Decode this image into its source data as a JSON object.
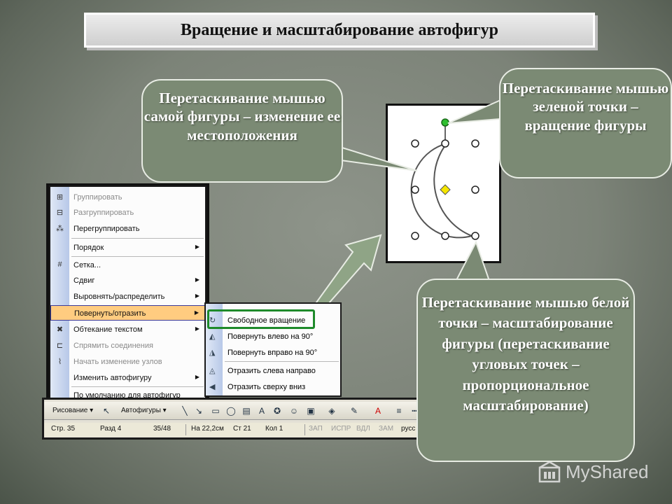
{
  "title": "Вращение и масштабирование автофигур",
  "callouts": {
    "move": "Перетаскивание мышью самой фигуры – изменение ее местоположения",
    "rotate": "Перетаскивание мышью зеленой точки – вращение фигуры",
    "scale": "Перетаскивание мышью белой точки – масштабирование фигуры (перетаскивание угловых точек – пропорциональное масштабирование)"
  },
  "menu": {
    "items": [
      {
        "label": "Группировать",
        "icon": "group-icon",
        "disabled": true,
        "submenu": false
      },
      {
        "label": "Разгруппировать",
        "icon": "ungroup-icon",
        "disabled": true,
        "submenu": false
      },
      {
        "label": "Перегруппировать",
        "icon": "regroup-icon",
        "disabled": false,
        "submenu": false
      },
      {
        "label": "Порядок",
        "icon": "",
        "disabled": false,
        "submenu": true
      },
      {
        "label": "Сетка...",
        "icon": "grid-icon",
        "disabled": false,
        "submenu": false
      },
      {
        "label": "Сдвиг",
        "icon": "",
        "disabled": false,
        "submenu": true
      },
      {
        "label": "Выровнять/распределить",
        "icon": "",
        "disabled": false,
        "submenu": true
      },
      {
        "label": "Повернуть/отразить",
        "icon": "",
        "disabled": false,
        "submenu": true,
        "selected": true
      },
      {
        "label": "Обтекание текстом",
        "icon": "text-wrap-icon",
        "disabled": false,
        "submenu": true
      },
      {
        "label": "Спрямить соединения",
        "icon": "straighten-icon",
        "disabled": true,
        "submenu": false
      },
      {
        "label": "Начать изменение узлов",
        "icon": "edit-points-icon",
        "disabled": true,
        "submenu": false
      },
      {
        "label": "Изменить автофигуру",
        "icon": "",
        "disabled": false,
        "submenu": true
      },
      {
        "label": "По умолчанию для автофигур",
        "icon": "",
        "disabled": false,
        "submenu": false
      }
    ]
  },
  "submenu": {
    "items": [
      {
        "label": "Свободное вращение",
        "icon": "free-rotate-icon"
      },
      {
        "label": "Повернуть влево на 90°",
        "icon": "rotate-left-icon"
      },
      {
        "label": "Повернуть вправо на 90°",
        "icon": "rotate-right-icon"
      },
      {
        "label": "Отразить слева направо",
        "icon": "flip-horizontal-icon"
      },
      {
        "label": "Отразить сверху вниз",
        "icon": "flip-vertical-icon"
      }
    ]
  },
  "toolbar": {
    "draw_label": "Рисование ▾",
    "autoshapes_label": "Автофигуры ▾"
  },
  "statusbar": {
    "page": "Стр.  35",
    "section": "Разд  4",
    "pages": "35/48",
    "position": "На 22,2см",
    "line": "Ст  21",
    "column": "Кол  1",
    "rec": "ЗАП",
    "trk": "ИСПР",
    "ext": "ВДЛ",
    "ovr": "ЗАМ",
    "lang": "русс"
  },
  "watermark": "MyShared",
  "colors": {
    "handle_green": "#2fbf2f",
    "handle_yellow": "#f5e600",
    "menu_highlight": "#ffcc80",
    "submenu_box": "#1e8a2a"
  }
}
